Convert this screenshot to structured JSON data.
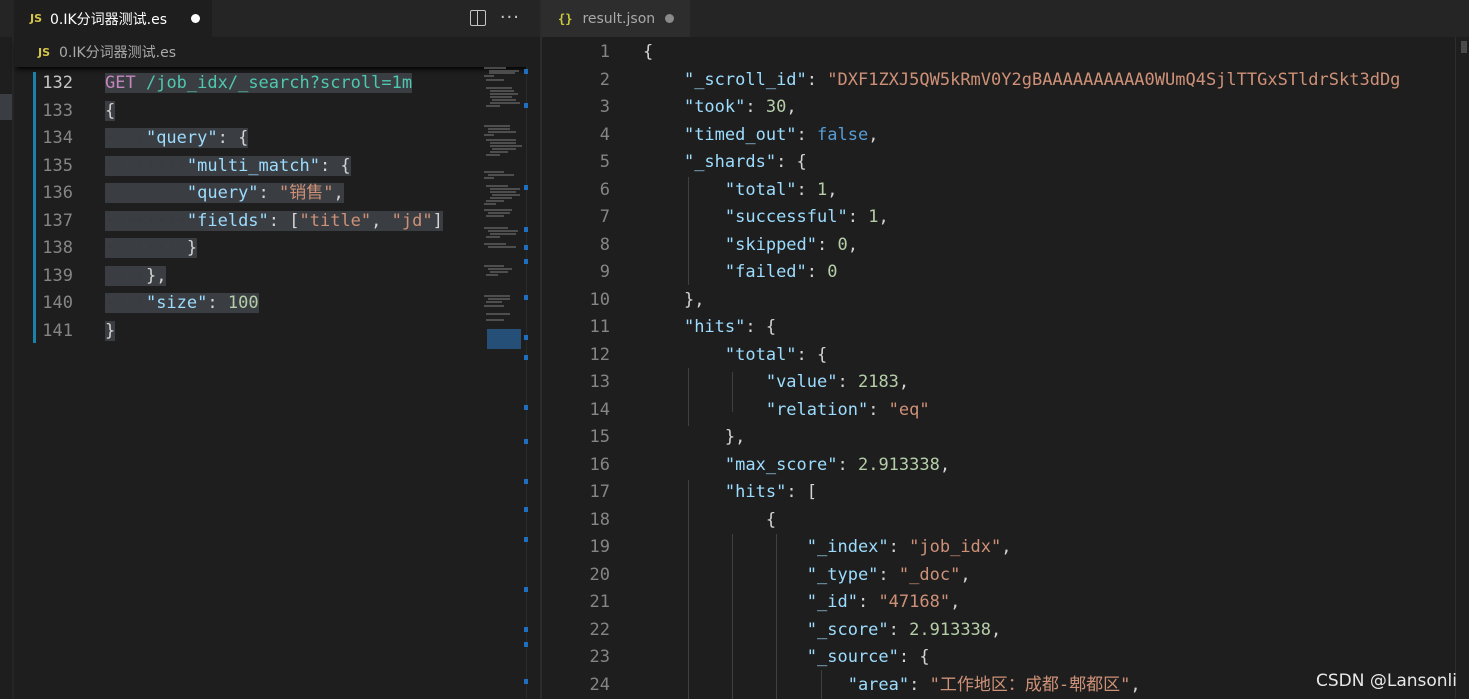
{
  "left_editor": {
    "tab_label": "0.IK分词器测试.es",
    "tab_icon": "JS",
    "breadcrumb_label": "0.IK分词器测试.es",
    "breadcrumb_icon": "JS",
    "lines": [
      {
        "num": "132",
        "active": true,
        "tokens": [
          {
            "t": "m",
            "v": "GET"
          },
          {
            "t": "p",
            "v": " "
          },
          {
            "t": "u",
            "v": "/job_idx/_search?scroll=1m"
          }
        ]
      },
      {
        "num": "133",
        "tokens": [
          {
            "t": "p",
            "v": "{"
          }
        ]
      },
      {
        "num": "134",
        "tokens": [
          {
            "t": "dot",
            "v": "····"
          },
          {
            "t": "k",
            "v": "\"query\""
          },
          {
            "t": "p",
            "v": ": {"
          }
        ]
      },
      {
        "num": "135",
        "tokens": [
          {
            "t": "dot",
            "v": "········"
          },
          {
            "t": "k",
            "v": "\"multi_match\""
          },
          {
            "t": "p",
            "v": ": {"
          }
        ]
      },
      {
        "num": "136",
        "tokens": [
          {
            "t": "dot",
            "v": "········"
          },
          {
            "t": "k",
            "v": "\"query\""
          },
          {
            "t": "p",
            "v": ": "
          },
          {
            "t": "s",
            "v": "\"销售\""
          },
          {
            "t": "p",
            "v": ","
          }
        ]
      },
      {
        "num": "137",
        "tokens": [
          {
            "t": "dot",
            "v": "········"
          },
          {
            "t": "k",
            "v": "\"fields\""
          },
          {
            "t": "p",
            "v": ": ["
          },
          {
            "t": "s",
            "v": "\"title\""
          },
          {
            "t": "p",
            "v": ", "
          },
          {
            "t": "s",
            "v": "\"jd\""
          },
          {
            "t": "p",
            "v": "]"
          }
        ]
      },
      {
        "num": "138",
        "tokens": [
          {
            "t": "dot",
            "v": "········"
          },
          {
            "t": "p",
            "v": "}"
          }
        ]
      },
      {
        "num": "139",
        "tokens": [
          {
            "t": "dot",
            "v": "····"
          },
          {
            "t": "p",
            "v": "},"
          }
        ]
      },
      {
        "num": "140",
        "tokens": [
          {
            "t": "dot",
            "v": "····"
          },
          {
            "t": "k",
            "v": "\"size\""
          },
          {
            "t": "p",
            "v": ": "
          },
          {
            "t": "n",
            "v": "100"
          }
        ]
      },
      {
        "num": "141",
        "tokens": [
          {
            "t": "p",
            "v": "}"
          }
        ]
      }
    ]
  },
  "right_editor": {
    "tab_label": "result.json",
    "tab_icon": "{}",
    "lines": [
      {
        "num": "1",
        "tokens": [
          {
            "t": "p",
            "v": "{"
          }
        ]
      },
      {
        "num": "2",
        "tokens": [
          {
            "t": "p",
            "v": "    "
          },
          {
            "t": "k",
            "v": "\"_scroll_id\""
          },
          {
            "t": "p",
            "v": ": "
          },
          {
            "t": "s",
            "v": "\"DXF1ZXJ5QW5kRmV0Y2gBAAAAAAAAAA0WUmQ4SjlTTGxSTldrSkt3dDg"
          }
        ]
      },
      {
        "num": "3",
        "tokens": [
          {
            "t": "p",
            "v": "    "
          },
          {
            "t": "k",
            "v": "\"took\""
          },
          {
            "t": "p",
            "v": ": "
          },
          {
            "t": "n",
            "v": "30"
          },
          {
            "t": "p",
            "v": ","
          }
        ]
      },
      {
        "num": "4",
        "tokens": [
          {
            "t": "p",
            "v": "    "
          },
          {
            "t": "k",
            "v": "\"timed_out\""
          },
          {
            "t": "p",
            "v": ": "
          },
          {
            "t": "b",
            "v": "false"
          },
          {
            "t": "p",
            "v": ","
          }
        ]
      },
      {
        "num": "5",
        "tokens": [
          {
            "t": "p",
            "v": "    "
          },
          {
            "t": "k",
            "v": "\"_shards\""
          },
          {
            "t": "p",
            "v": ": {"
          }
        ]
      },
      {
        "num": "6",
        "tokens": [
          {
            "t": "p",
            "v": "        "
          },
          {
            "t": "k",
            "v": "\"total\""
          },
          {
            "t": "p",
            "v": ": "
          },
          {
            "t": "n",
            "v": "1"
          },
          {
            "t": "p",
            "v": ","
          }
        ]
      },
      {
        "num": "7",
        "tokens": [
          {
            "t": "p",
            "v": "        "
          },
          {
            "t": "k",
            "v": "\"successful\""
          },
          {
            "t": "p",
            "v": ": "
          },
          {
            "t": "n",
            "v": "1"
          },
          {
            "t": "p",
            "v": ","
          }
        ]
      },
      {
        "num": "8",
        "tokens": [
          {
            "t": "p",
            "v": "        "
          },
          {
            "t": "k",
            "v": "\"skipped\""
          },
          {
            "t": "p",
            "v": ": "
          },
          {
            "t": "n",
            "v": "0"
          },
          {
            "t": "p",
            "v": ","
          }
        ]
      },
      {
        "num": "9",
        "tokens": [
          {
            "t": "p",
            "v": "        "
          },
          {
            "t": "k",
            "v": "\"failed\""
          },
          {
            "t": "p",
            "v": ": "
          },
          {
            "t": "n",
            "v": "0"
          }
        ]
      },
      {
        "num": "10",
        "tokens": [
          {
            "t": "p",
            "v": "    "
          },
          {
            "t": "p",
            "v": "},"
          }
        ]
      },
      {
        "num": "11",
        "tokens": [
          {
            "t": "p",
            "v": "    "
          },
          {
            "t": "k",
            "v": "\"hits\""
          },
          {
            "t": "p",
            "v": ": {"
          }
        ]
      },
      {
        "num": "12",
        "tokens": [
          {
            "t": "p",
            "v": "        "
          },
          {
            "t": "k",
            "v": "\"total\""
          },
          {
            "t": "p",
            "v": ": {"
          }
        ]
      },
      {
        "num": "13",
        "tokens": [
          {
            "t": "p",
            "v": "            "
          },
          {
            "t": "k",
            "v": "\"value\""
          },
          {
            "t": "p",
            "v": ": "
          },
          {
            "t": "n",
            "v": "2183"
          },
          {
            "t": "p",
            "v": ","
          }
        ]
      },
      {
        "num": "14",
        "tokens": [
          {
            "t": "p",
            "v": "            "
          },
          {
            "t": "k",
            "v": "\"relation\""
          },
          {
            "t": "p",
            "v": ": "
          },
          {
            "t": "s",
            "v": "\"eq\""
          }
        ]
      },
      {
        "num": "15",
        "tokens": [
          {
            "t": "p",
            "v": "        "
          },
          {
            "t": "p",
            "v": "},"
          }
        ]
      },
      {
        "num": "16",
        "tokens": [
          {
            "t": "p",
            "v": "        "
          },
          {
            "t": "k",
            "v": "\"max_score\""
          },
          {
            "t": "p",
            "v": ": "
          },
          {
            "t": "n",
            "v": "2.913338"
          },
          {
            "t": "p",
            "v": ","
          }
        ]
      },
      {
        "num": "17",
        "tokens": [
          {
            "t": "p",
            "v": "        "
          },
          {
            "t": "k",
            "v": "\"hits\""
          },
          {
            "t": "p",
            "v": ": ["
          }
        ]
      },
      {
        "num": "18",
        "tokens": [
          {
            "t": "p",
            "v": "            "
          },
          {
            "t": "p",
            "v": "{"
          }
        ]
      },
      {
        "num": "19",
        "tokens": [
          {
            "t": "p",
            "v": "                "
          },
          {
            "t": "k",
            "v": "\"_index\""
          },
          {
            "t": "p",
            "v": ": "
          },
          {
            "t": "s",
            "v": "\"job_idx\""
          },
          {
            "t": "p",
            "v": ","
          }
        ]
      },
      {
        "num": "20",
        "tokens": [
          {
            "t": "p",
            "v": "                "
          },
          {
            "t": "k",
            "v": "\"_type\""
          },
          {
            "t": "p",
            "v": ": "
          },
          {
            "t": "s",
            "v": "\"_doc\""
          },
          {
            "t": "p",
            "v": ","
          }
        ]
      },
      {
        "num": "21",
        "tokens": [
          {
            "t": "p",
            "v": "                "
          },
          {
            "t": "k",
            "v": "\"_id\""
          },
          {
            "t": "p",
            "v": ": "
          },
          {
            "t": "s",
            "v": "\"47168\""
          },
          {
            "t": "p",
            "v": ","
          }
        ]
      },
      {
        "num": "22",
        "tokens": [
          {
            "t": "p",
            "v": "                "
          },
          {
            "t": "k",
            "v": "\"_score\""
          },
          {
            "t": "p",
            "v": ": "
          },
          {
            "t": "n",
            "v": "2.913338"
          },
          {
            "t": "p",
            "v": ","
          }
        ]
      },
      {
        "num": "23",
        "tokens": [
          {
            "t": "p",
            "v": "                "
          },
          {
            "t": "k",
            "v": "\"_source\""
          },
          {
            "t": "p",
            "v": ": {"
          }
        ]
      },
      {
        "num": "24",
        "tokens": [
          {
            "t": "p",
            "v": "                    "
          },
          {
            "t": "k",
            "v": "\"area\""
          },
          {
            "t": "p",
            "v": ": "
          },
          {
            "t": "s",
            "v": "\"工作地区：成都-郫都区\""
          },
          {
            "t": "p",
            "v": ","
          }
        ]
      }
    ]
  },
  "watermark": "CSDN @Lansonli"
}
